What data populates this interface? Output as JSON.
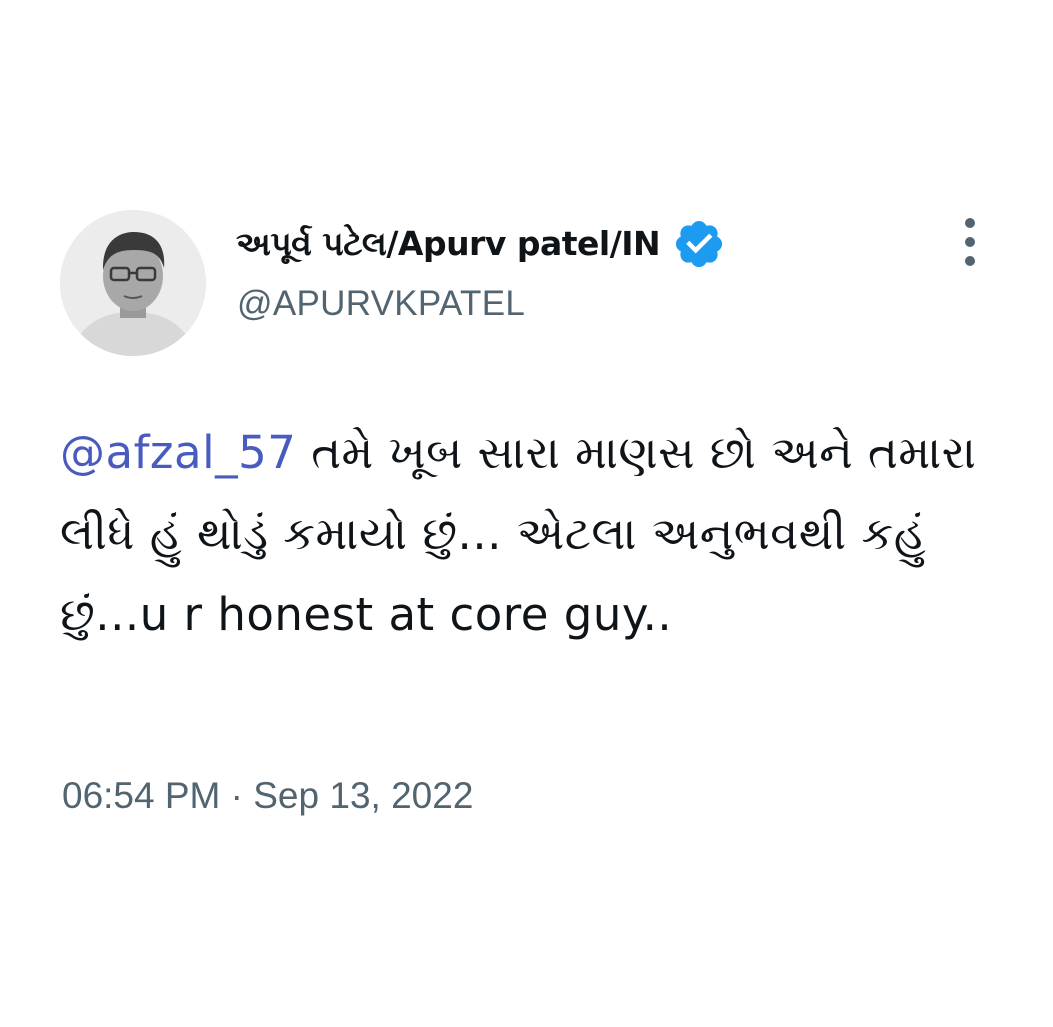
{
  "tweet": {
    "author": {
      "display_name": "અપૂર્વ પટેલ/Apurv patel/IN",
      "handle": "@APURVKPATEL",
      "verified": true,
      "verified_color": "#1d9bf0",
      "avatar_icon": "profile-photo"
    },
    "more_icon": "vertical-ellipsis-icon",
    "body": {
      "mention": "@afzal_57",
      "text": " તમે ખૂબ સારા માણસ છો અને તમારા લીધે હું થોડું કમાયો છું... એટલા અનુભવથી કહું છું...u r honest at core guy.."
    },
    "timestamp": "06:54 PM · Sep 13, 2022"
  },
  "colors": {
    "text": "#0f1419",
    "secondary": "#536471",
    "mention": "#4a5bbf",
    "background": "#ffffff"
  }
}
